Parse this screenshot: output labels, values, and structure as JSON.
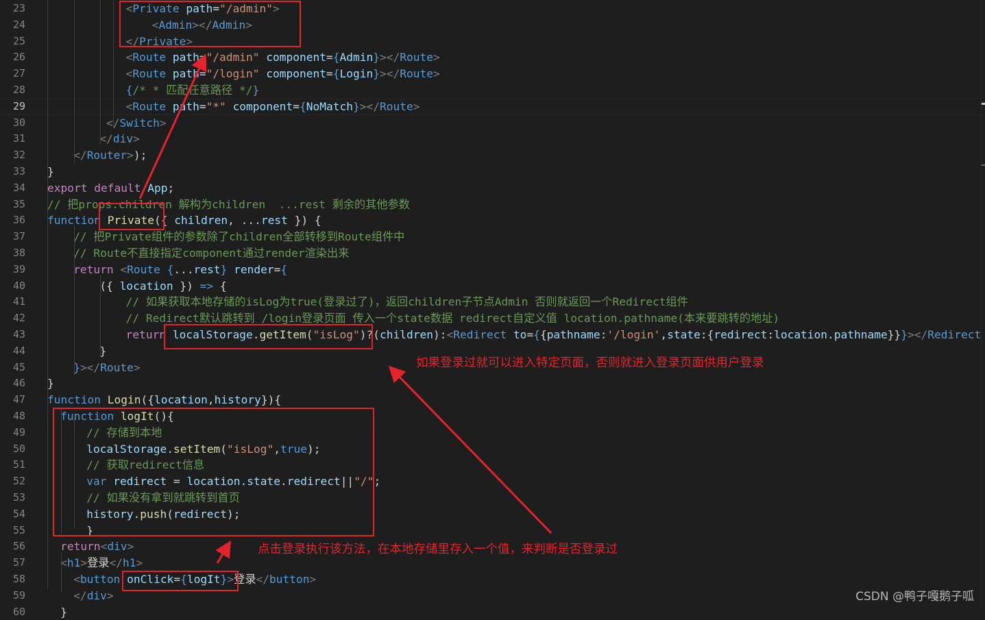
{
  "editor": {
    "lines": [
      {
        "n": "23",
        "t": [
          [
            "pun",
            "<"
          ],
          [
            "tag",
            "Private"
          ],
          [
            "txt",
            " "
          ],
          [
            "var",
            "path"
          ],
          [
            "txt",
            "="
          ],
          [
            "str",
            "\"/admin\""
          ],
          [
            "pun",
            ">"
          ]
        ]
      },
      {
        "n": "24",
        "t": [
          [
            "pun",
            "<"
          ],
          [
            "tag",
            "Admin"
          ],
          [
            "pun",
            "></"
          ],
          [
            "tag",
            "Admin"
          ],
          [
            "pun",
            ">"
          ]
        ]
      },
      {
        "n": "25",
        "t": [
          [
            "pun",
            "</"
          ],
          [
            "tag",
            "Private"
          ],
          [
            "pun",
            ">"
          ]
        ]
      },
      {
        "n": "26",
        "t": [
          [
            "pun",
            "<"
          ],
          [
            "tag",
            "Route"
          ],
          [
            "txt",
            " "
          ],
          [
            "var",
            "path"
          ],
          [
            "txt",
            "="
          ],
          [
            "str",
            "\"/admin\""
          ],
          [
            "txt",
            " "
          ],
          [
            "var",
            "component"
          ],
          [
            "txt",
            "="
          ],
          [
            "kw",
            "{"
          ],
          [
            "var",
            "Admin"
          ],
          [
            "kw",
            "}"
          ],
          [
            "pun",
            "></"
          ],
          [
            "tag",
            "Route"
          ],
          [
            "pun",
            ">"
          ]
        ]
      },
      {
        "n": "27",
        "t": [
          [
            "pun",
            "<"
          ],
          [
            "tag",
            "Route"
          ],
          [
            "txt",
            " "
          ],
          [
            "var",
            "path"
          ],
          [
            "txt",
            "="
          ],
          [
            "str",
            "\"/login\""
          ],
          [
            "txt",
            " "
          ],
          [
            "var",
            "component"
          ],
          [
            "txt",
            "="
          ],
          [
            "kw",
            "{"
          ],
          [
            "var",
            "Login"
          ],
          [
            "kw",
            "}"
          ],
          [
            "pun",
            "></"
          ],
          [
            "tag",
            "Route"
          ],
          [
            "pun",
            ">"
          ]
        ]
      },
      {
        "n": "28",
        "t": [
          [
            "kw",
            "{"
          ],
          [
            "cmt",
            "/* * 匹配任意路径 */"
          ],
          [
            "kw",
            "}"
          ]
        ]
      },
      {
        "n": "29",
        "t": [
          [
            "pun",
            "<"
          ],
          [
            "tag",
            "Route"
          ],
          [
            "txt",
            " "
          ],
          [
            "var",
            "path"
          ],
          [
            "txt",
            "="
          ],
          [
            "str",
            "\"*\""
          ],
          [
            "txt",
            " "
          ],
          [
            "var",
            "component"
          ],
          [
            "txt",
            "="
          ],
          [
            "kw",
            "{"
          ],
          [
            "var",
            "NoMatch"
          ],
          [
            "kw",
            "}"
          ],
          [
            "pun",
            ">"
          ],
          [
            "pun",
            "</"
          ],
          [
            "tag",
            "Route"
          ],
          [
            "pun",
            ">"
          ]
        ]
      },
      {
        "n": "30",
        "t": [
          [
            "pun",
            "</"
          ],
          [
            "tag",
            "Switch"
          ],
          [
            "pun",
            ">"
          ]
        ]
      },
      {
        "n": "31",
        "t": [
          [
            "pun",
            "</"
          ],
          [
            "tag",
            "div"
          ],
          [
            "pun",
            ">"
          ]
        ]
      },
      {
        "n": "32",
        "t": [
          [
            "pun",
            "</"
          ],
          [
            "tag",
            "Router"
          ],
          [
            "pun",
            ">"
          ],
          [
            "txt",
            ");"
          ]
        ]
      },
      {
        "n": "33",
        "t": [
          [
            "txt",
            "}"
          ]
        ]
      },
      {
        "n": "34",
        "t": [
          [
            "ctl",
            "export"
          ],
          [
            "txt",
            " "
          ],
          [
            "ctl",
            "default"
          ],
          [
            "txt",
            " "
          ],
          [
            "var",
            "App"
          ],
          [
            "txt",
            ";"
          ]
        ]
      },
      {
        "n": "35",
        "t": [
          [
            "cmt",
            "// 把props.children 解构为children  ...rest 剩余的其他参数"
          ]
        ]
      },
      {
        "n": "36",
        "t": [
          [
            "kw",
            "function"
          ],
          [
            "txt",
            " "
          ],
          [
            "fn",
            "Private"
          ],
          [
            "txt",
            "({ "
          ],
          [
            "var",
            "children"
          ],
          [
            "txt",
            ", ..."
          ],
          [
            "var",
            "rest"
          ],
          [
            "txt",
            " }) {"
          ]
        ]
      },
      {
        "n": "37",
        "t": [
          [
            "cmt",
            "// 把Private组件的参数除了children全部转移到Route组件中"
          ]
        ]
      },
      {
        "n": "38",
        "t": [
          [
            "cmt",
            "// Route不直接指定component通过render渲染出来"
          ]
        ]
      },
      {
        "n": "39",
        "t": [
          [
            "ctl",
            "return"
          ],
          [
            "txt",
            " "
          ],
          [
            "pun",
            "<"
          ],
          [
            "tag",
            "Route"
          ],
          [
            "txt",
            " "
          ],
          [
            "kw",
            "{"
          ],
          [
            "txt",
            "..."
          ],
          [
            "var",
            "rest"
          ],
          [
            "kw",
            "}"
          ],
          [
            "txt",
            " "
          ],
          [
            "var",
            "render"
          ],
          [
            "txt",
            "="
          ],
          [
            "kw",
            "{"
          ]
        ]
      },
      {
        "n": "40",
        "t": [
          [
            "txt",
            "({ "
          ],
          [
            "var",
            "location"
          ],
          [
            "txt",
            " }) "
          ],
          [
            "kw",
            "=>"
          ],
          [
            "txt",
            " {"
          ]
        ]
      },
      {
        "n": "41",
        "t": [
          [
            "cmt",
            "// 如果获取本地存储的isLog为true(登录过了)，返回children子节点Admin 否则就返回一个Redirect组件"
          ]
        ]
      },
      {
        "n": "42",
        "t": [
          [
            "cmt",
            "// Redirect默认跳转到 /login登录页面 传入一个state数据 redirect自定义值 location.pathname(本来要跳转的地址)"
          ]
        ]
      },
      {
        "n": "43",
        "t": [
          [
            "ctl",
            "return"
          ],
          [
            "txt",
            " "
          ],
          [
            "var",
            "localStorage"
          ],
          [
            "txt",
            "."
          ],
          [
            "fn",
            "getItem"
          ],
          [
            "txt",
            "("
          ],
          [
            "str",
            "\"isLog\""
          ],
          [
            "txt",
            ")?("
          ],
          [
            "var",
            "children"
          ],
          [
            "txt",
            "):"
          ],
          [
            "pun",
            "<"
          ],
          [
            "tag",
            "Redirect"
          ],
          [
            "txt",
            " "
          ],
          [
            "var",
            "to"
          ],
          [
            "txt",
            "="
          ],
          [
            "kw",
            "{"
          ],
          [
            "txt",
            "{"
          ],
          [
            "var",
            "pathname"
          ],
          [
            "txt",
            ":"
          ],
          [
            "str",
            "'/login'"
          ],
          [
            "txt",
            ","
          ],
          [
            "var",
            "state"
          ],
          [
            "txt",
            ":{"
          ],
          [
            "var",
            "redirect"
          ],
          [
            "txt",
            ":"
          ],
          [
            "var",
            "location"
          ],
          [
            "txt",
            "."
          ],
          [
            "var",
            "pathname"
          ],
          [
            "txt",
            "}}"
          ],
          [
            "kw",
            "}"
          ],
          [
            "pun",
            "></"
          ],
          [
            "tag",
            "Redirect"
          ],
          [
            "pun",
            ">"
          ]
        ]
      },
      {
        "n": "44",
        "t": [
          [
            "txt",
            "}"
          ]
        ]
      },
      {
        "n": "45",
        "t": [
          [
            "kw",
            "}"
          ],
          [
            "pun",
            "></"
          ],
          [
            "tag",
            "Route"
          ],
          [
            "pun",
            ">"
          ]
        ]
      },
      {
        "n": "46",
        "t": [
          [
            "txt",
            "}"
          ]
        ]
      },
      {
        "n": "47",
        "t": [
          [
            "kw",
            "function"
          ],
          [
            "txt",
            " "
          ],
          [
            "fn",
            "Login"
          ],
          [
            "txt",
            "({"
          ],
          [
            "var",
            "location"
          ],
          [
            "txt",
            ","
          ],
          [
            "var",
            "history"
          ],
          [
            "txt",
            "}){"
          ]
        ]
      },
      {
        "n": "48",
        "t": [
          [
            "kw",
            "function"
          ],
          [
            "txt",
            " "
          ],
          [
            "fn",
            "logIt"
          ],
          [
            "txt",
            "(){"
          ]
        ]
      },
      {
        "n": "49",
        "t": [
          [
            "cmt",
            "// 存储到本地"
          ]
        ]
      },
      {
        "n": "50",
        "t": [
          [
            "var",
            "localStorage"
          ],
          [
            "txt",
            "."
          ],
          [
            "fn",
            "setItem"
          ],
          [
            "txt",
            "("
          ],
          [
            "str",
            "\"isLog\""
          ],
          [
            "txt",
            ","
          ],
          [
            "kw",
            "true"
          ],
          [
            "txt",
            ");"
          ]
        ]
      },
      {
        "n": "51",
        "t": [
          [
            "cmt",
            "// 获取redirect信息"
          ]
        ]
      },
      {
        "n": "52",
        "t": [
          [
            "kw",
            "var"
          ],
          [
            "txt",
            " "
          ],
          [
            "var",
            "redirect"
          ],
          [
            "txt",
            " = "
          ],
          [
            "var",
            "location"
          ],
          [
            "txt",
            "."
          ],
          [
            "var",
            "state"
          ],
          [
            "txt",
            "."
          ],
          [
            "var",
            "redirect"
          ],
          [
            "txt",
            "||"
          ],
          [
            "str",
            "\"/\""
          ],
          [
            "txt",
            ";"
          ]
        ]
      },
      {
        "n": "53",
        "t": [
          [
            "cmt",
            "// 如果没有拿到就跳转到首页"
          ]
        ]
      },
      {
        "n": "54",
        "t": [
          [
            "var",
            "history"
          ],
          [
            "txt",
            "."
          ],
          [
            "fn",
            "push"
          ],
          [
            "txt",
            "("
          ],
          [
            "var",
            "redirect"
          ],
          [
            "txt",
            ");"
          ]
        ]
      },
      {
        "n": "55",
        "t": [
          [
            "txt",
            "}"
          ]
        ]
      },
      {
        "n": "56",
        "t": [
          [
            "ctl",
            "return"
          ],
          [
            "pun",
            "<"
          ],
          [
            "tag",
            "div"
          ],
          [
            "pun",
            ">"
          ]
        ]
      },
      {
        "n": "57",
        "t": [
          [
            "pun",
            "<"
          ],
          [
            "tag",
            "h1"
          ],
          [
            "pun",
            ">"
          ],
          [
            "txt",
            "登录"
          ],
          [
            "pun",
            "</"
          ],
          [
            "tag",
            "h1"
          ],
          [
            "pun",
            ">"
          ]
        ]
      },
      {
        "n": "58",
        "t": [
          [
            "pun",
            "<"
          ],
          [
            "tag",
            "button"
          ],
          [
            "txt",
            " "
          ],
          [
            "var",
            "onClick"
          ],
          [
            "txt",
            "="
          ],
          [
            "kw",
            "{"
          ],
          [
            "var",
            "logIt"
          ],
          [
            "kw",
            "}"
          ],
          [
            "pun",
            ">"
          ],
          [
            "txt",
            "登录"
          ],
          [
            "pun",
            "</"
          ],
          [
            "tag",
            "button"
          ],
          [
            "pun",
            ">"
          ]
        ]
      },
      {
        "n": "59",
        "t": [
          [
            "pun",
            "</"
          ],
          [
            "tag",
            "div"
          ],
          [
            "pun",
            ">"
          ]
        ]
      },
      {
        "n": "60",
        "t": [
          [
            "txt",
            "}"
          ]
        ]
      }
    ]
  },
  "annotations": {
    "note_redirect": "如果登录过就可以进入特定页面，否则就进入登录页面供用户登录",
    "note_login": "点击登录执行该方法，在本地存储里存入一个值，来判断是否登录过"
  },
  "watermark": "CSDN @鸭子嘎鹅子呱",
  "colors": {
    "background": "#1e1e1e",
    "annotation": "#e5232c",
    "keyword": "#569cd6",
    "control": "#c586c0",
    "string": "#ce9178",
    "comment": "#6a9955",
    "variable": "#9cdcfe",
    "function": "#dcdcaa"
  }
}
